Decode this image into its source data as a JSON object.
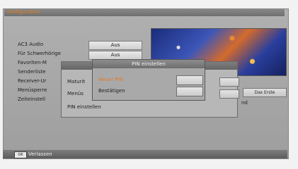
{
  "screen": {
    "title": "Konfiguration"
  },
  "menu": {
    "items": [
      {
        "label": "AC3 Audio",
        "value": "Aus"
      },
      {
        "label": "Für Schwerhörige",
        "value": "Aus"
      },
      {
        "label": "Favoriten-M"
      },
      {
        "label": "Senderliste"
      },
      {
        "label": "Receiver-Ur"
      },
      {
        "label": "Menüsperre"
      },
      {
        "label": "Zeiteinstell"
      }
    ]
  },
  "dialog_outer": {
    "rows": [
      {
        "label": "Maturit"
      },
      {
        "label": "Menüs"
      },
      {
        "label": "PIN einstellen"
      }
    ]
  },
  "dialog_inner": {
    "title": "PIN einstellen",
    "rows": [
      {
        "label": "Neuer PIN",
        "color": "#e07b2a"
      },
      {
        "label": "Bestätigen",
        "color": "#1e1e1e"
      }
    ]
  },
  "side": {
    "tag_label": "Das Erste",
    "fragment": "nd"
  },
  "footer": {
    "key_label": "OK",
    "label": "Verlassen"
  }
}
